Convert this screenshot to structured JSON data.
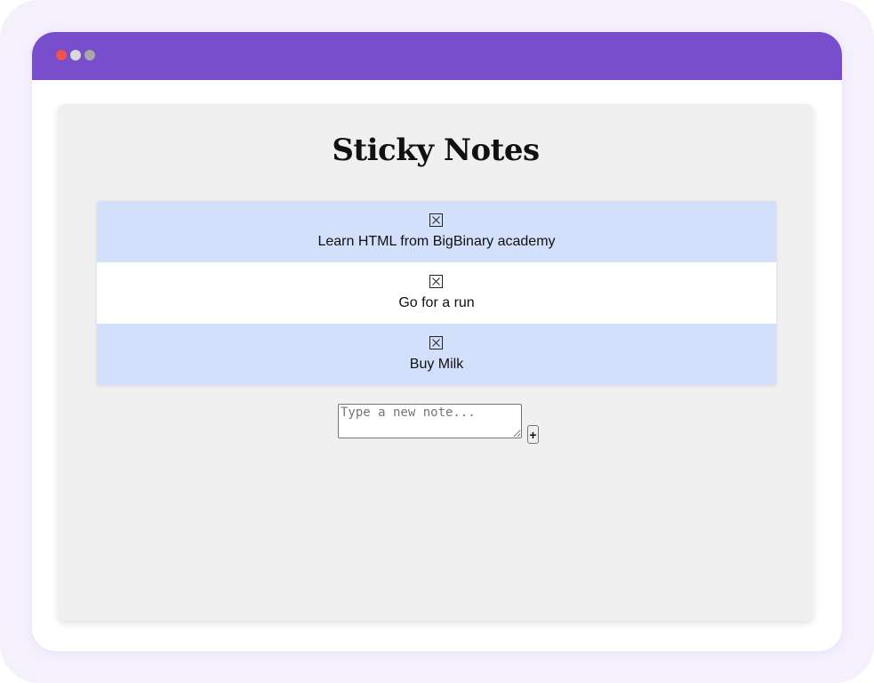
{
  "window": {
    "title_bar_color": "#784ecd",
    "dots": [
      "red-dot",
      "light-dot",
      "gray-dot"
    ]
  },
  "app": {
    "title": "Sticky Notes"
  },
  "notes": [
    {
      "text": "Learn HTML from BigBinary academy",
      "delete_icon": "close-box-icon",
      "color": "#d2e0fc"
    },
    {
      "text": "Go for a run",
      "delete_icon": "close-box-icon",
      "color": "#ffffff"
    },
    {
      "text": "Buy Milk",
      "delete_icon": "close-box-icon",
      "color": "#d2e0fc"
    }
  ],
  "new_note": {
    "placeholder": "Type a new note...",
    "value": "",
    "add_label": "+"
  }
}
